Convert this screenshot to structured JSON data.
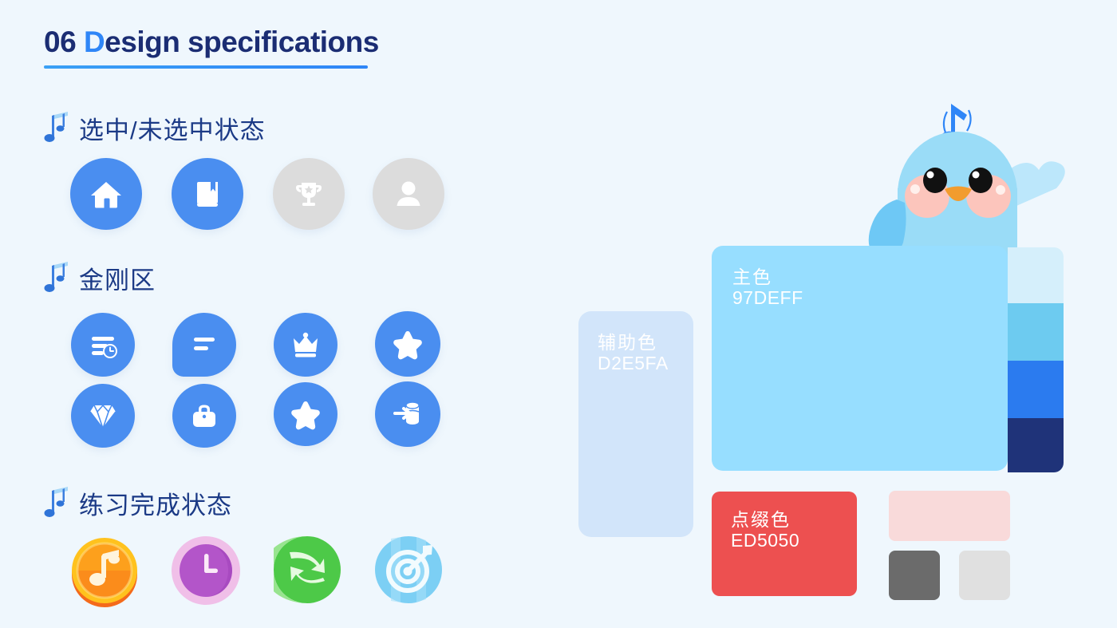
{
  "page": {
    "background_color": "#EFF7FD"
  },
  "header": {
    "number": "06",
    "highlight_letter": "D",
    "title_rest": "esign specifications",
    "full_title": "06 Design specifications",
    "accent_color": "#2F86F7",
    "title_color": "#1B2D73"
  },
  "sections": [
    {
      "id": "selected-states",
      "icon": "music-note-icon",
      "label": "选中/未选中状态",
      "items": [
        {
          "name": "home-icon",
          "state": "selected",
          "circle_color": "#4A8EF0"
        },
        {
          "name": "book-icon",
          "state": "selected",
          "circle_color": "#4A8EF0"
        },
        {
          "name": "trophy-icon",
          "state": "unselected",
          "circle_color": "#DCDCDC"
        },
        {
          "name": "person-icon",
          "state": "unselected",
          "circle_color": "#DCDCDC"
        }
      ]
    },
    {
      "id": "kingkong-zone",
      "icon": "music-note-icon",
      "label": "金刚区",
      "items": [
        {
          "name": "list-clock-icon",
          "circle_color": "#4A8EF0"
        },
        {
          "name": "speech-bubble-icon",
          "circle_color": "#4A8EF0"
        },
        {
          "name": "crown-icon",
          "circle_color": "#4A8EF0"
        },
        {
          "name": "star-badge-icon",
          "circle_color": "#4A8EF0"
        },
        {
          "name": "diamond-icon",
          "circle_color": "#4A8EF0"
        },
        {
          "name": "shopping-bag-icon",
          "circle_color": "#4A8EF0"
        },
        {
          "name": "star-icon",
          "circle_color": "#4A8EF0"
        },
        {
          "name": "coin-stack-icon",
          "circle_color": "#4A8EF0"
        }
      ]
    },
    {
      "id": "practice-completion",
      "icon": "music-note-icon",
      "label": "练习完成状态",
      "items": [
        {
          "name": "music-coin-icon",
          "circle_color": "#F7A11E"
        },
        {
          "name": "clock-icon",
          "circle_color": "#B355C9"
        },
        {
          "name": "refresh-icon",
          "circle_color": "#4DC948"
        },
        {
          "name": "target-dart-icon",
          "circle_color": "#6BC8F2"
        }
      ]
    }
  ],
  "palette": {
    "swatches": [
      {
        "name": "辅助色",
        "hex": "D2E5FA",
        "color": "#D2E5FA",
        "label_visible": true
      },
      {
        "name": "主色",
        "hex": "97DEFF",
        "color": "#97DEFF",
        "label_visible": true
      },
      {
        "name": "点缀色",
        "hex": "ED5050",
        "color": "#ED5050",
        "label_visible": true
      }
    ],
    "tints": [
      {
        "name": "tint-lightest",
        "color": "#D5EFFB"
      },
      {
        "name": "tint-light",
        "color": "#6DCBF0"
      },
      {
        "name": "tint-mid",
        "color": "#2B7BEF"
      },
      {
        "name": "tint-dark",
        "color": "#1F3379"
      }
    ],
    "neutrals": [
      {
        "name": "accent-tint",
        "color": "#F9DADA"
      },
      {
        "name": "neutral-dark",
        "color": "#6B6B6B"
      },
      {
        "name": "neutral-light",
        "color": "#E0E0E0"
      }
    ]
  },
  "mascot": {
    "name": "bird-mascot",
    "body_color": "#9ADCF7",
    "cheek_color": "#FCC5BC",
    "beak_color": "#F29C2E",
    "note_color": "#2F86F7",
    "wing_color": "#6EC8F5",
    "tail_color": "#B9E6FB"
  }
}
